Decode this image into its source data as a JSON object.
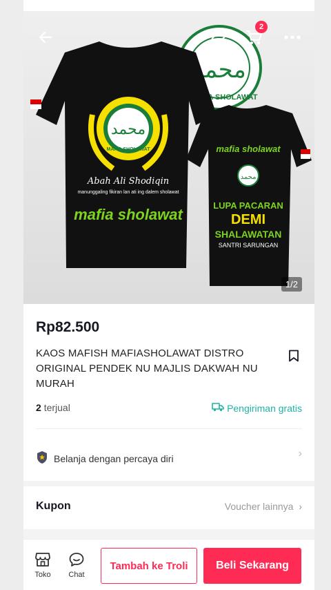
{
  "hero": {
    "page_indicator": "1/2",
    "cart_count": "2"
  },
  "product": {
    "price": "Rp82.500",
    "title": "KAOS MAFISH MAFIASHOLAWAT DISTRO ORIGINAL PENDEK NU MAJLIS DAKWAH NU MURAH",
    "sold_count": "2",
    "sold_suffix": "terjual",
    "shipping_label": "Pengiriman gratis"
  },
  "trust": {
    "label": "Belanja dengan percaya diri"
  },
  "coupon": {
    "label": "Kupon",
    "more": "Voucher lainnya"
  },
  "bottom_bar": {
    "shop_label": "Toko",
    "chat_label": "Chat",
    "add_to_cart": "Tambah ke Troli",
    "buy_now": "Beli Sekarang"
  },
  "artwork": {
    "front_name": "Abah Ali Shodiqin",
    "front_line": "manunggaling fikiran lan ati ing dalem sholawat",
    "front_brand": "mafia sholawat",
    "badge_text": "MAFIA SHOLAWAT",
    "back_brand": "mafia sholawat",
    "back_line1": "LUPA PACARAN",
    "back_line2": "DEMI",
    "back_line3": "SHALAWATAN",
    "back_line4": "SANTRI SARUNGAN"
  },
  "colors": {
    "accent": "#fe2c55",
    "shipping": "#1fb4a4",
    "shirt_green": "#7ed321",
    "shirt_yellow": "#f5e000"
  }
}
